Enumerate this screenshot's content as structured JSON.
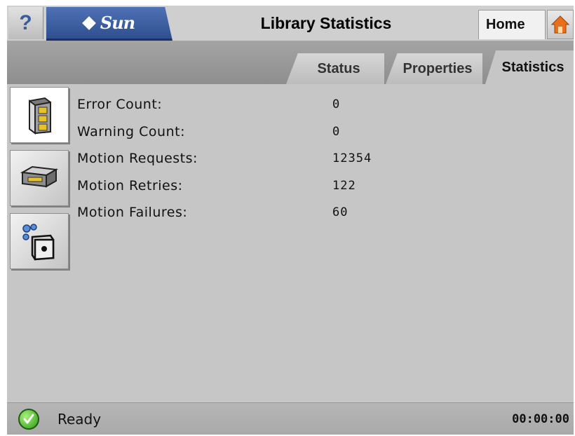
{
  "header": {
    "help_label": "?",
    "logo_text": "Sun",
    "title": "Library Statistics",
    "home_label": "Home"
  },
  "tabs": [
    {
      "label": "Status",
      "active": false
    },
    {
      "label": "Properties",
      "active": false
    },
    {
      "label": "Statistics",
      "active": true
    }
  ],
  "sidebar": {
    "items": [
      {
        "icon": "library-icon",
        "active": true
      },
      {
        "icon": "tape-drive-icon",
        "active": false
      },
      {
        "icon": "media-cartridge-icon",
        "active": false
      }
    ]
  },
  "stats": [
    {
      "label": "Error Count:",
      "value": "0"
    },
    {
      "label": "Warning Count:",
      "value": "0"
    },
    {
      "label": "Motion Requests:",
      "value": "12354"
    },
    {
      "label": "Motion Retries:",
      "value": "122"
    },
    {
      "label": "Motion Failures:",
      "value": "60"
    }
  ],
  "status_bar": {
    "status_icon": "check-icon",
    "text": "Ready",
    "time": "00:00:00"
  },
  "colors": {
    "accent_blue": "#3f5fa3",
    "home_orange": "#e8701c",
    "ready_green": "#2b9b15"
  }
}
